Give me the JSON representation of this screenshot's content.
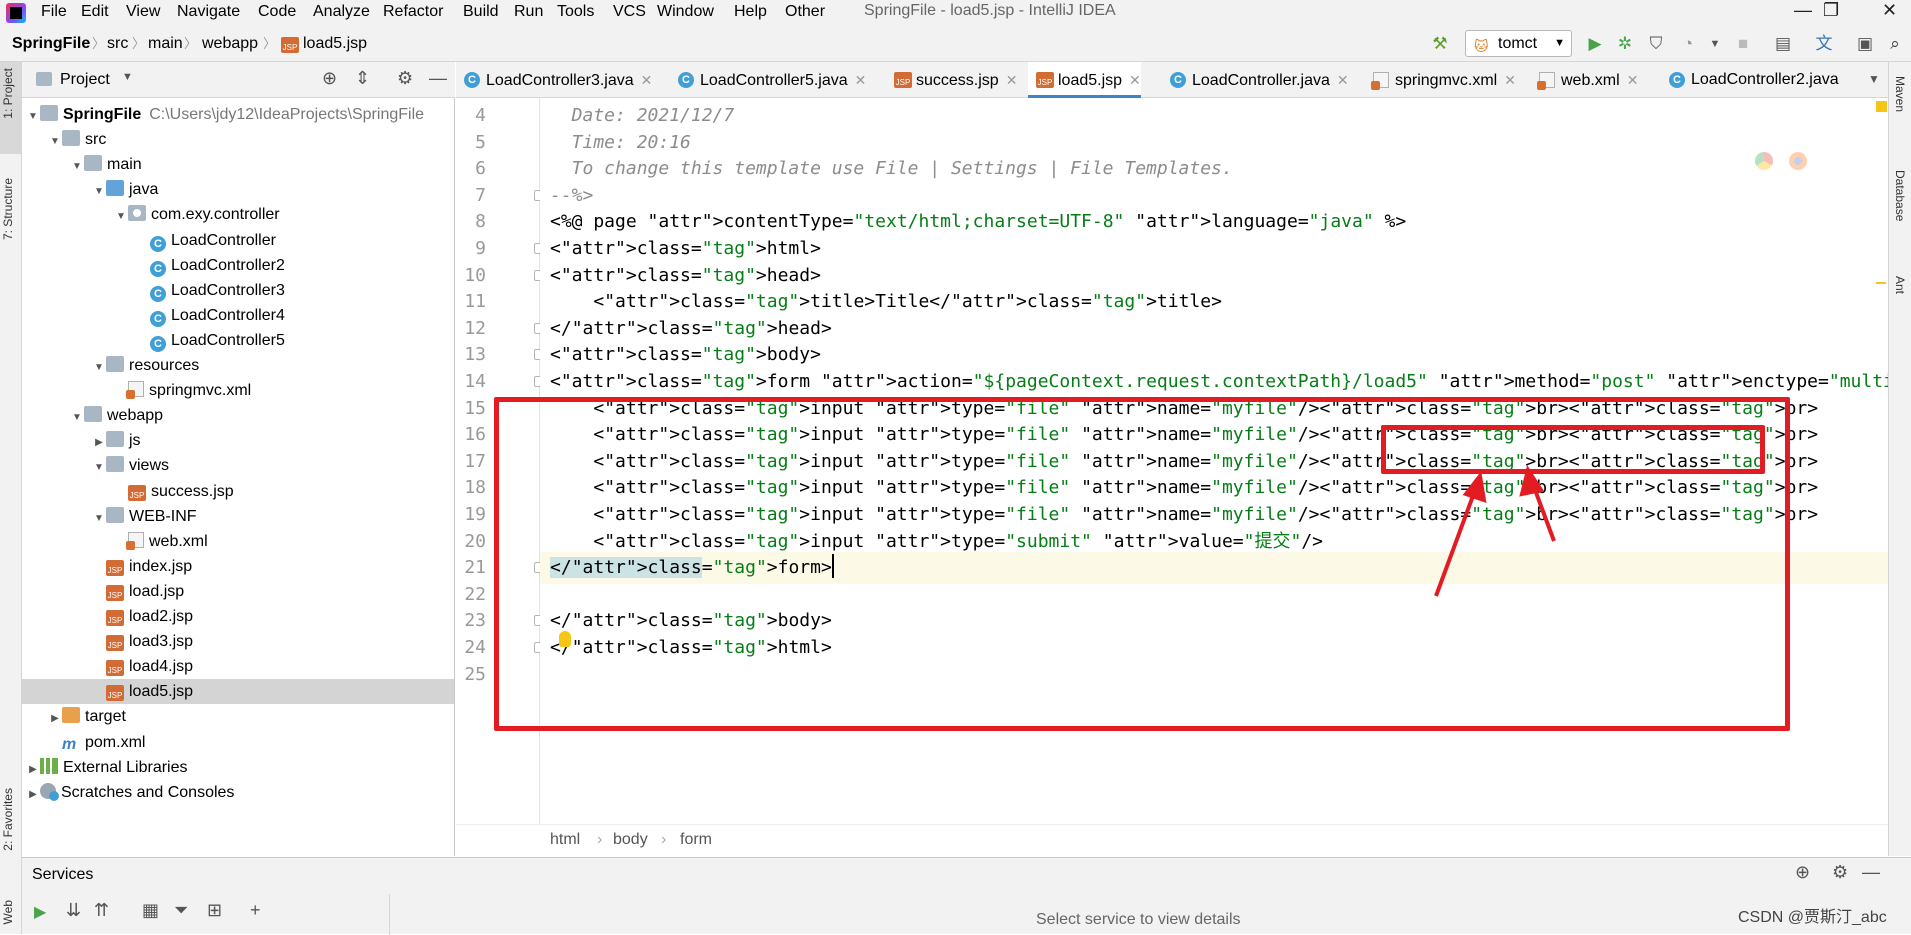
{
  "menubar": {
    "items": [
      "File",
      "Edit",
      "View",
      "Navigate",
      "Code",
      "Analyze",
      "Refactor",
      "Build",
      "Run",
      "Tools",
      "VCS",
      "Window",
      "Help",
      "Other"
    ],
    "window_title": "SpringFile - load5.jsp - IntelliJ IDEA"
  },
  "navbar": {
    "crumbs": [
      "SpringFile",
      "src",
      "main",
      "webapp",
      "load5.jsp"
    ],
    "run_config": "tomct"
  },
  "left_stripe": {
    "project": "1: Project",
    "structure": "7: Structure",
    "favorites": "2: Favorites",
    "web": "Web"
  },
  "right_stripe": {
    "maven": "Maven",
    "database": "Database",
    "ant": "Ant"
  },
  "project_panel": {
    "title": "Project",
    "tree": [
      {
        "label": "SpringFile",
        "extra": "C:\\Users\\jdy12\\IdeaProjects\\SpringFile",
        "icon": "folder-icon",
        "bold": true,
        "arrow": "▼"
      },
      {
        "label": "src",
        "icon": "folder-icon",
        "arrow": "▼"
      },
      {
        "label": "main",
        "icon": "folder-icon",
        "arrow": "▼"
      },
      {
        "label": "java",
        "icon": "source-folder-icon",
        "arrow": "▼"
      },
      {
        "label": "com.exy.controller",
        "icon": "package-icon",
        "arrow": "▼"
      },
      {
        "label": "LoadController",
        "icon": "class-icon"
      },
      {
        "label": "LoadController2",
        "icon": "class-icon"
      },
      {
        "label": "LoadController3",
        "icon": "class-icon"
      },
      {
        "label": "LoadController4",
        "icon": "class-icon"
      },
      {
        "label": "LoadController5",
        "icon": "class-icon"
      },
      {
        "label": "resources",
        "icon": "resources-folder-icon",
        "arrow": "▼"
      },
      {
        "label": "springmvc.xml",
        "icon": "xml-icon"
      },
      {
        "label": "webapp",
        "icon": "folder-icon",
        "arrow": "▼"
      },
      {
        "label": "js",
        "icon": "folder-icon",
        "arrow": "▶"
      },
      {
        "label": "views",
        "icon": "folder-icon",
        "arrow": "▼"
      },
      {
        "label": "success.jsp",
        "icon": "jsp-icon"
      },
      {
        "label": "WEB-INF",
        "icon": "folder-icon",
        "arrow": "▼"
      },
      {
        "label": "web.xml",
        "icon": "xml-icon"
      },
      {
        "label": "index.jsp",
        "icon": "jsp-icon"
      },
      {
        "label": "load.jsp",
        "icon": "jsp-icon"
      },
      {
        "label": "load2.jsp",
        "icon": "jsp-icon"
      },
      {
        "label": "load3.jsp",
        "icon": "jsp-icon"
      },
      {
        "label": "load4.jsp",
        "icon": "jsp-icon"
      },
      {
        "label": "load5.jsp",
        "icon": "jsp-icon",
        "selected": true
      },
      {
        "label": "target",
        "icon": "excluded-folder-icon",
        "arrow": "▶"
      },
      {
        "label": "pom.xml",
        "icon": "maven-icon"
      },
      {
        "label": "External Libraries",
        "icon": "library-icon",
        "arrow": "▶"
      },
      {
        "label": "Scratches and Consoles",
        "icon": "scratch-icon",
        "arrow": "▶"
      }
    ]
  },
  "tabs": [
    {
      "label": "LoadController3.java",
      "icon": "class-icon"
    },
    {
      "label": "LoadController5.java",
      "icon": "class-icon"
    },
    {
      "label": "success.jsp",
      "icon": "jsp-icon"
    },
    {
      "label": "load5.jsp",
      "icon": "jsp-icon",
      "active": true
    },
    {
      "label": "LoadController.java",
      "icon": "class-icon"
    },
    {
      "label": "springmvc.xml",
      "icon": "xml-icon"
    },
    {
      "label": "web.xml",
      "icon": "xml-icon"
    },
    {
      "label": "LoadController2.java",
      "icon": "class-icon"
    }
  ],
  "editor": {
    "line_numbers": [
      "4",
      "5",
      "6",
      "7",
      "8",
      "9",
      "10",
      "11",
      "12",
      "13",
      "14",
      "15",
      "16",
      "17",
      "18",
      "19",
      "20",
      "21",
      "22",
      "23",
      "24",
      "25"
    ],
    "current_line": "21",
    "code": [
      "  Date: 2021/12/7",
      "  Time: 20:16",
      "  To change this template use File | Settings | File Templates.",
      "--%>",
      "<%@ page contentType=\"text/html;charset=UTF-8\" language=\"java\" %>",
      "<html>",
      "<head>",
      "    <title>Title</title>",
      "</head>",
      "<body>",
      "<form action=\"${pageContext.request.contextPath}/load5\" method=\"post\" enctype=\"multipart/form-data\">",
      "    <input type=\"file\" name=\"myfile\"/><br><br>",
      "    <input type=\"file\" name=\"myfile\"/><br><br>",
      "    <input type=\"file\" name=\"myfile\"/><br><br>",
      "    <input type=\"file\" name=\"myfile\"/><br><br>",
      "    <input type=\"file\" name=\"myfile\"/><br><br>",
      "    <input type=\"submit\" value=\"提交\"/>",
      "</form>",
      "",
      "</body>",
      "</html>",
      ""
    ],
    "breadcrumb": [
      "html",
      "body",
      "form"
    ]
  },
  "services": {
    "title": "Services",
    "empty_text": "Select service to view details"
  },
  "watermark": "CSDN @贾斯汀_abc",
  "colors": {
    "annotation_red": "#e31b23",
    "accent_blue": "#4083c9"
  }
}
